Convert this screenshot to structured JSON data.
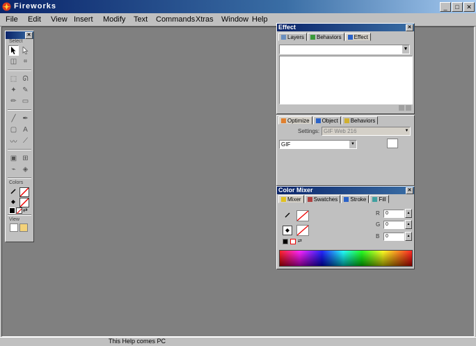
{
  "window": {
    "title": "Fireworks",
    "minimize_glyph": "_",
    "maximize_glyph": "□",
    "close_glyph": "✕"
  },
  "menu": [
    "File",
    "Edit",
    "View",
    "Insert",
    "Modify",
    "Text",
    "Commands",
    "Xtras",
    "Window",
    "Help"
  ],
  "tools_panel": {
    "close_glyph": "✕",
    "section_select": "Select",
    "section_colors": "Colors",
    "section_view": "View"
  },
  "effect_panel": {
    "title": "Effect",
    "tabs": [
      "Layers",
      "Behaviors",
      "Effect"
    ],
    "close_glyph": "✕"
  },
  "object_panel": {
    "tabs": [
      "Optimize",
      "Object",
      "Behaviors"
    ],
    "settings_label": "Settings:",
    "settings_value": "GIF Web 216",
    "format_value": "GIF"
  },
  "color_mixer": {
    "title": "Color Mixer",
    "close_glyph": "✕",
    "tabs": [
      "Mixer",
      "Swatches",
      "Stroke",
      "Fill"
    ],
    "r_label": "R",
    "g_label": "G",
    "b_label": "B",
    "r_value": "0",
    "g_value": "0",
    "b_value": "0"
  },
  "status": {
    "text": "This Help comes PC"
  },
  "colors": {
    "title_dark": "#0a246a",
    "workspace": "#808080",
    "face": "#c0c0c0"
  }
}
